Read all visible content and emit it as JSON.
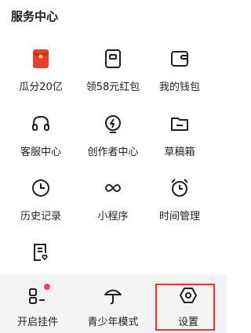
{
  "section": {
    "title": "服务中心"
  },
  "grid": [
    {
      "label": "瓜分20亿",
      "icon": "red-envelope-icon"
    },
    {
      "label": "领58元红包",
      "icon": "coupon-card-icon"
    },
    {
      "label": "我的钱包",
      "icon": "wallet-icon"
    },
    {
      "label": "客服中心",
      "icon": "headset-icon"
    },
    {
      "label": "创作者中心",
      "icon": "lightning-circle-icon"
    },
    {
      "label": "草稿箱",
      "icon": "folder-icon"
    },
    {
      "label": "历史记录",
      "icon": "clock-icon"
    },
    {
      "label": "小程序",
      "icon": "mini-program-icon"
    },
    {
      "label": "时间管理",
      "icon": "alarm-clock-icon"
    },
    {
      "label": "",
      "icon": "document-heart-icon"
    }
  ],
  "bottom": [
    {
      "label": "开启挂件",
      "icon": "widget-icon",
      "badge": true
    },
    {
      "label": "青少年模式",
      "icon": "umbrella-icon"
    },
    {
      "label": "设置",
      "icon": "hexagon-settings-icon"
    }
  ],
  "colors": {
    "accent_red": "#e8402f",
    "badge": "#f0426a",
    "highlight": "#ff2a2a"
  }
}
